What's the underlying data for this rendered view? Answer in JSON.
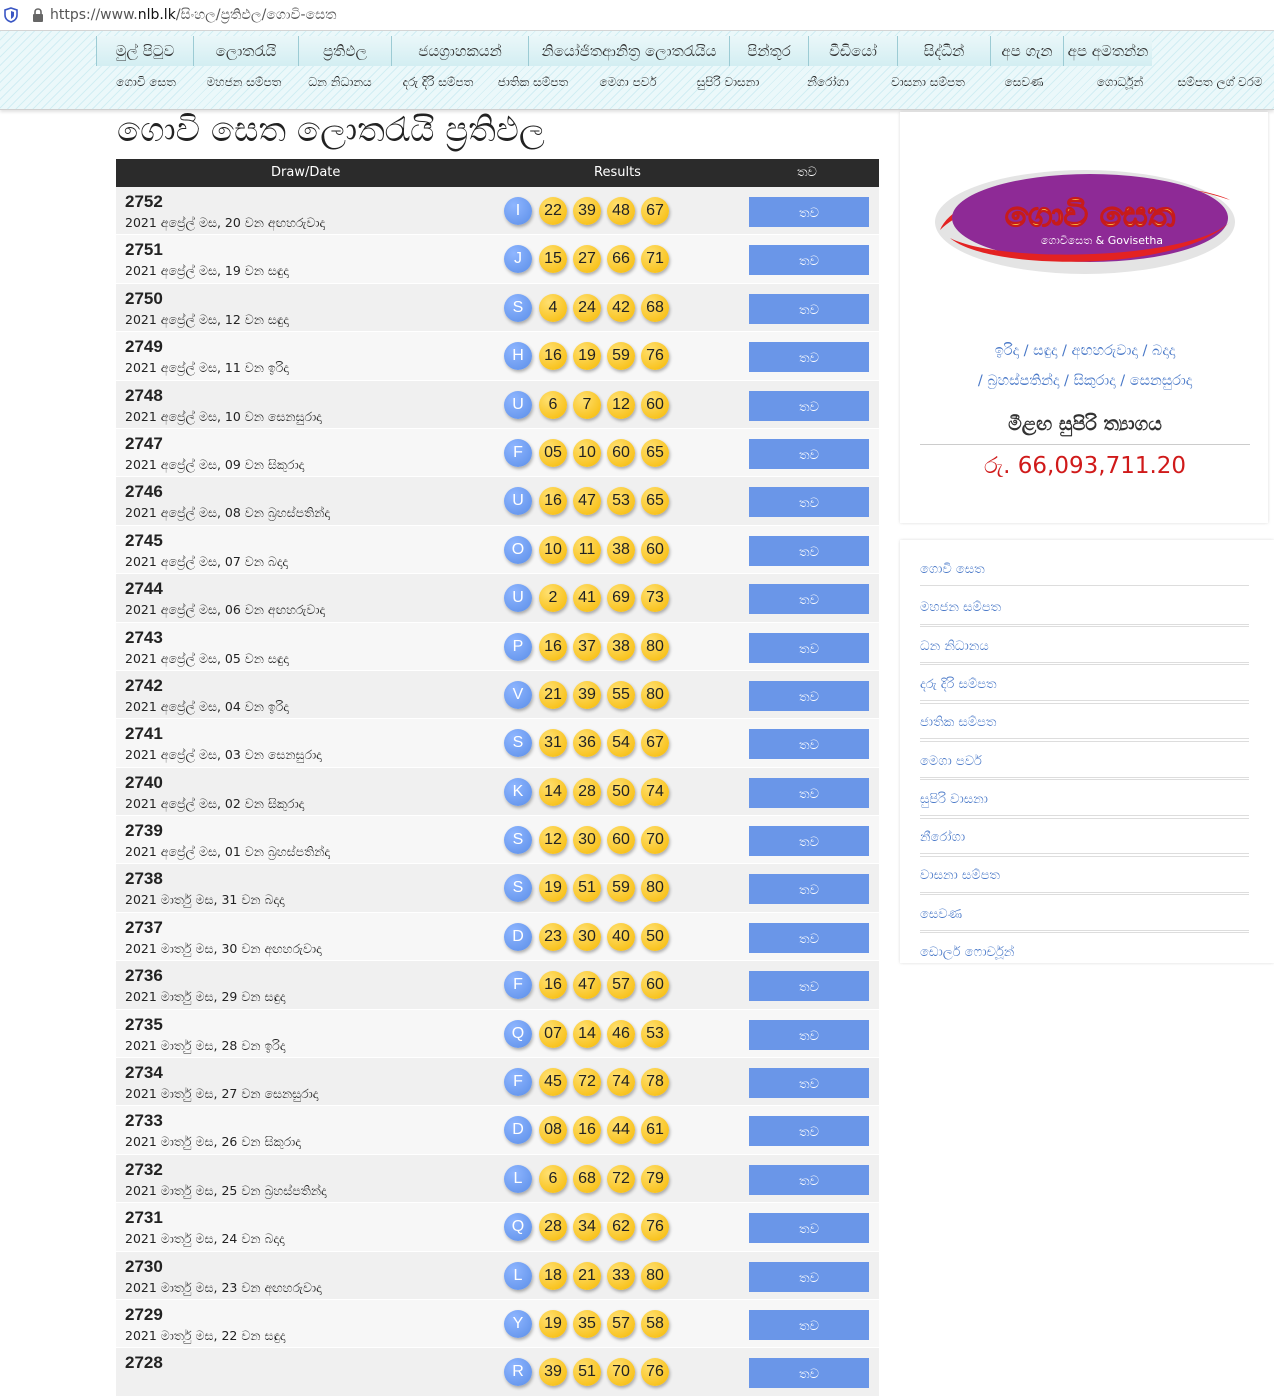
{
  "browser": {
    "url_prefix": "https://www.",
    "url_host": "nlb.lk",
    "url_path": "/සිංහල/ප්‍රතිඵල/ගොවි-සෙත"
  },
  "nav": {
    "top": [
      "මුල් පිටුව",
      "ලොතරැයි",
      "ප්‍රතිඵල",
      "ජයග්‍රාහකයන්",
      "නියෝජිතආනිත්‍ර ලොතරැයිය",
      "පින්තූර",
      "වීඩියෝ",
      "සිද්ධීන්",
      "අප ගැන",
      "අප අමතන්න"
    ],
    "sub": [
      "ගොවි සෙත",
      "මහජන සම්පත",
      "ධන නිධානය",
      "දරු දිරි සම්පත",
      "ජාතික සම්පත",
      "මෙගා පවර්",
      "සුපිරි වාසනා",
      "නීරෝගා",
      "වාසනා සම්පත",
      "සෙවණ",
      "ගොර්ධූන්",
      "සම්පත ලග් වරම"
    ]
  },
  "page_title": "ගොවි සෙත ලොතරැයි ප්‍රතිඵල",
  "table": {
    "headers": {
      "draw": "Draw/Date",
      "results": "Results",
      "action": "තව"
    },
    "button_label": "තව",
    "rows": [
      {
        "num": "2752",
        "date": "2021 අප්‍රේල් මස, 20 වන අඟහරුවාදා",
        "letter": "I",
        "balls": [
          "22",
          "39",
          "48",
          "67"
        ]
      },
      {
        "num": "2751",
        "date": "2021 අප්‍රේල් මස, 19 වන සඳුදා",
        "letter": "J",
        "balls": [
          "15",
          "27",
          "66",
          "71"
        ]
      },
      {
        "num": "2750",
        "date": "2021 අප්‍රේල් මස, 12 වන සඳුදා",
        "letter": "S",
        "balls": [
          "4",
          "24",
          "42",
          "68"
        ]
      },
      {
        "num": "2749",
        "date": "2021 අප්‍රේල් මස, 11 වන ඉරිදා",
        "letter": "H",
        "balls": [
          "16",
          "19",
          "59",
          "76"
        ]
      },
      {
        "num": "2748",
        "date": "2021 අප්‍රේල් මස, 10 වන සෙනසුරාදා",
        "letter": "U",
        "balls": [
          "6",
          "7",
          "12",
          "60"
        ]
      },
      {
        "num": "2747",
        "date": "2021 අප්‍රේල් මස, 09 වන සිකුරාදා",
        "letter": "F",
        "balls": [
          "05",
          "10",
          "60",
          "65"
        ]
      },
      {
        "num": "2746",
        "date": "2021 අප්‍රේල් මස, 08 වන බ්‍රහස්පතින්දා",
        "letter": "U",
        "balls": [
          "16",
          "47",
          "53",
          "65"
        ]
      },
      {
        "num": "2745",
        "date": "2021 අප්‍රේල් මස, 07 වන බදාදා",
        "letter": "O",
        "balls": [
          "10",
          "11",
          "38",
          "60"
        ]
      },
      {
        "num": "2744",
        "date": "2021 අප්‍රේල් මස, 06 වන අඟහරුවාදා",
        "letter": "U",
        "balls": [
          "2",
          "41",
          "69",
          "73"
        ]
      },
      {
        "num": "2743",
        "date": "2021 අප්‍රේල් මස, 05 වන සඳුදා",
        "letter": "P",
        "balls": [
          "16",
          "37",
          "38",
          "80"
        ]
      },
      {
        "num": "2742",
        "date": "2021 අප්‍රේල් මස, 04 වන ඉරිදා",
        "letter": "V",
        "balls": [
          "21",
          "39",
          "55",
          "80"
        ]
      },
      {
        "num": "2741",
        "date": "2021 අප්‍රේල් මස, 03 වන සෙනසුරාදා",
        "letter": "S",
        "balls": [
          "31",
          "36",
          "54",
          "67"
        ]
      },
      {
        "num": "2740",
        "date": "2021 අප්‍රේල් මස, 02 වන සිකුරාදා",
        "letter": "K",
        "balls": [
          "14",
          "28",
          "50",
          "74"
        ]
      },
      {
        "num": "2739",
        "date": "2021 අප්‍රේල් මස, 01 වන බ්‍රහස්පතින්දා",
        "letter": "S",
        "balls": [
          "12",
          "30",
          "60",
          "70"
        ]
      },
      {
        "num": "2738",
        "date": "2021 මාර්තු මස, 31 වන බදාදා",
        "letter": "S",
        "balls": [
          "19",
          "51",
          "59",
          "80"
        ]
      },
      {
        "num": "2737",
        "date": "2021 මාර්තු මස, 30 වන අඟහරුවාදා",
        "letter": "D",
        "balls": [
          "23",
          "30",
          "40",
          "50"
        ]
      },
      {
        "num": "2736",
        "date": "2021 මාර්තු මස, 29 වන සඳුදා",
        "letter": "F",
        "balls": [
          "16",
          "47",
          "57",
          "60"
        ]
      },
      {
        "num": "2735",
        "date": "2021 මාර්තු මස, 28 වන ඉරිදා",
        "letter": "Q",
        "balls": [
          "07",
          "14",
          "46",
          "53"
        ]
      },
      {
        "num": "2734",
        "date": "2021 මාර්තු මස, 27 වන සෙනසුරාදා",
        "letter": "F",
        "balls": [
          "45",
          "72",
          "74",
          "78"
        ]
      },
      {
        "num": "2733",
        "date": "2021 මාර්තු මස, 26 වන සිකුරාදා",
        "letter": "D",
        "balls": [
          "08",
          "16",
          "44",
          "61"
        ]
      },
      {
        "num": "2732",
        "date": "2021 මාර්තු මස, 25 වන බ්‍රහස්පතින්දා",
        "letter": "L",
        "balls": [
          "6",
          "68",
          "72",
          "79"
        ]
      },
      {
        "num": "2731",
        "date": "2021 මාර්තු මස, 24 වන බදාදා",
        "letter": "Q",
        "balls": [
          "28",
          "34",
          "62",
          "76"
        ]
      },
      {
        "num": "2730",
        "date": "2021 මාර්තු මස, 23 වන අඟහරුවාදා",
        "letter": "L",
        "balls": [
          "18",
          "21",
          "33",
          "80"
        ]
      },
      {
        "num": "2729",
        "date": "2021 මාර්තු මස, 22 වන සඳුදා",
        "letter": "Y",
        "balls": [
          "19",
          "35",
          "57",
          "58"
        ]
      },
      {
        "num": "2728",
        "date": "",
        "letter": "R",
        "balls": [
          "39",
          "51",
          "70",
          "76"
        ]
      }
    ]
  },
  "sidebar": {
    "logo_text": "ගොවි සෙත",
    "logo_sub": "ගොවිසෙත & Govisetha",
    "draw_days": [
      "ඉරිදා",
      "සඳුදා",
      "අඟහරුවාදා",
      "බදාදා",
      "බ්‍රහස්පතින්දා",
      "සිකුරාදා",
      "සෙනසුරාදා"
    ],
    "jackpot_label": "මීළඟ සුපිරි ත්‍යාගය",
    "jackpot_value": "රු. 66,093,711.20",
    "links": [
      "ගොවි සෙත",
      "මහජන සම්පත",
      "ධන නිධානය",
      "දරු දිරි සම්පත",
      "ජාතික සම්පත",
      "මෙගා පවර්",
      "සුපිරි වාසනා",
      "නීරෝගා",
      "වාසනා සම්පත",
      "සෙවණ",
      "ඩොලර් ෆොර්චූන්"
    ]
  },
  "colors": {
    "letter_ball": "#5b8ee8",
    "number_ball": "#f6b800",
    "button": "#6a96e8",
    "jackpot": "#d01a1a",
    "link": "#4a79c8"
  }
}
